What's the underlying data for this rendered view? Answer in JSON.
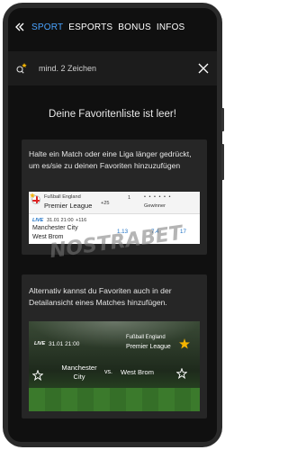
{
  "topnav": {
    "tabs": [
      {
        "label": "SPORT",
        "active": true
      },
      {
        "label": "ESPORTS",
        "active": false
      },
      {
        "label": "BONUS",
        "active": false
      },
      {
        "label": "INFOS",
        "active": false
      }
    ]
  },
  "search": {
    "placeholder": "mind. 2 Zeichen"
  },
  "empty_title": "Deine Favoritenliste ist leer!",
  "card1": {
    "text": "Halte ein Match oder eine Liga länger gedrückt, um es/sie zu deinen Favoriten hinzuzufügen",
    "sample": {
      "league_top": "Fußball England",
      "league": "Premier League",
      "more": "+25",
      "col_1": "1",
      "col_winner": "Gewinner",
      "live": "LIVE",
      "date": "31.01 21:00",
      "plus": "+116",
      "team1": "Manchester City",
      "team2": "West Brom",
      "odds": [
        "1.13",
        "7.4",
        "17"
      ]
    },
    "watermark": "NOSTRABET"
  },
  "card2": {
    "text": "Alternativ kannst du Favoriten auch in der Detailansicht eines Matches hinzufügen.",
    "detail": {
      "live": "LIVE",
      "date": "31.01 21:00",
      "league_top": "Fußball England",
      "league": "Premier League",
      "team1_line1": "Manchester",
      "team1_line2": "City",
      "vs": "vs.",
      "team2": "West Brom"
    }
  },
  "colors": {
    "accent": "#4aa3ff",
    "background": "#101010",
    "card": "#262626",
    "star": "#f5b400"
  }
}
